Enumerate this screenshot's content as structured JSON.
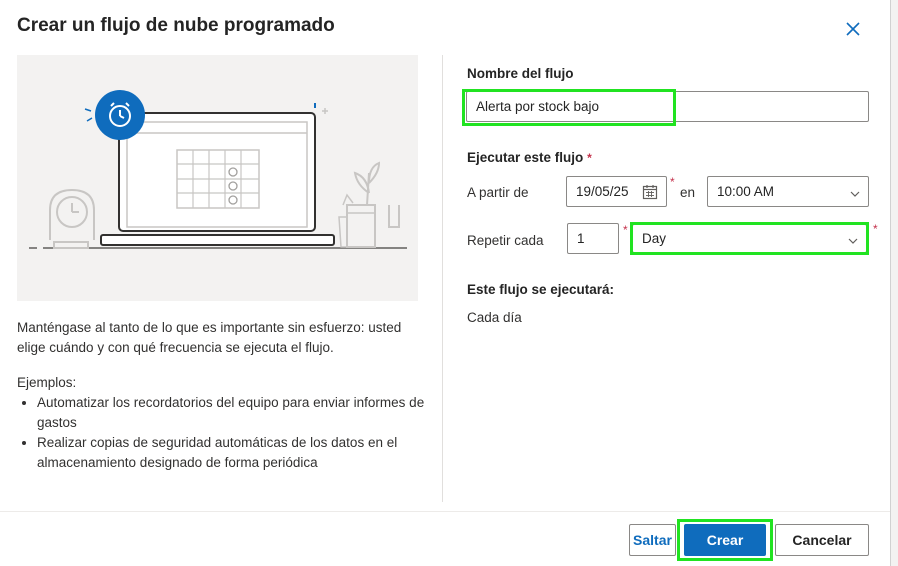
{
  "dialog": {
    "title": "Crear un flujo de nube programado",
    "close_icon": "close-icon",
    "description": "Manténgase al tanto de lo que es importante sin esfuerzo: usted elige cuándo y con qué frecuencia se ejecuta el flujo.",
    "examples_heading": "Ejemplos:",
    "examples": [
      "Automatizar los recordatorios del equipo para enviar informes de gastos",
      "Realizar copias de seguridad automáticas de los datos en el almacenamiento designado de forma periódica"
    ]
  },
  "form": {
    "flow_name_label": "Nombre del flujo",
    "flow_name_value": "Alerta por stock bajo",
    "run_label": "Ejecutar este flujo",
    "required_mark": "*",
    "start_label": "A partir de",
    "start_date": "19/05/25",
    "at_label": "en",
    "start_time": "10:00 AM",
    "repeat_label": "Repetir cada",
    "repeat_interval": "1",
    "repeat_unit": "Day",
    "summary_label": "Este flujo se ejecutará:",
    "summary_value": "Cada día"
  },
  "footer": {
    "skip_label": "Saltar",
    "create_label": "Crear",
    "cancel_label": "Cancelar"
  },
  "colors": {
    "accent": "#0f6cbd",
    "highlight": "#21e321",
    "required": "#c4314b"
  }
}
